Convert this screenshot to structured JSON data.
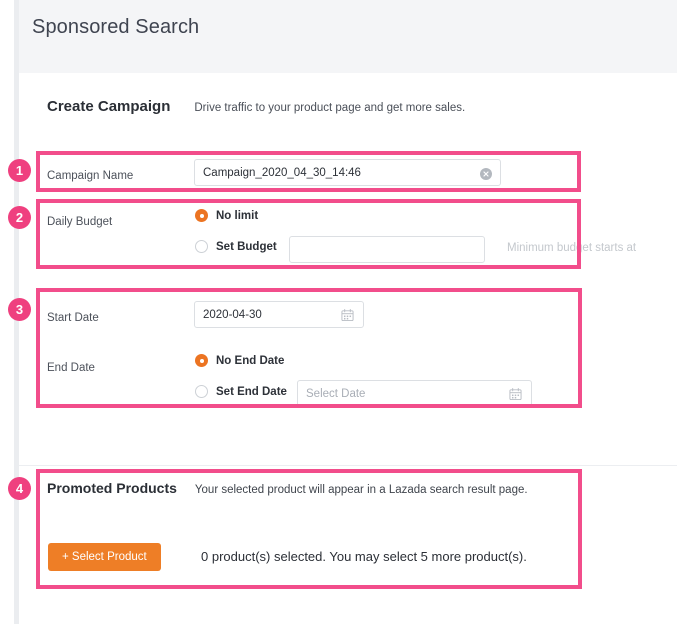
{
  "header": {
    "title": "Sponsored Search"
  },
  "section": {
    "title": "Create Campaign",
    "subtitle": "Drive traffic to your product page and get more sales."
  },
  "form": {
    "campaign_name": {
      "label": "Campaign Name",
      "value": "Campaign_2020_04_30_14:46",
      "clear_icon": "clear-circle-icon"
    },
    "daily_budget": {
      "label": "Daily Budget",
      "option_no_limit": "No limit",
      "option_set_budget": "Set Budget",
      "selected": "No limit",
      "budget_value": "",
      "budget_placeholder": "",
      "hint": "Minimum budget starts at"
    },
    "start_date": {
      "label": "Start Date",
      "value": "2020-04-30",
      "calendar_icon": "calendar-icon"
    },
    "end_date": {
      "label": "End Date",
      "option_no_end_date": "No End Date",
      "option_set_end_date": "Set End Date",
      "selected": "No End Date",
      "end_date_value": "",
      "end_date_placeholder": "Select Date",
      "calendar_icon": "calendar-icon"
    }
  },
  "promoted": {
    "title": "Promoted Products",
    "subtitle": "Your selected product will appear in a Lazada search result page.",
    "button_label": "+ Select Product",
    "status": "0 product(s) selected. You may select 5 more product(s)."
  },
  "annotations": {
    "badges": [
      "1",
      "2",
      "3",
      "4"
    ]
  },
  "colors": {
    "accent_orange": "#ee7e26",
    "annotation_pink": "#f24d8b",
    "header_gray": "#f4f5f7"
  }
}
